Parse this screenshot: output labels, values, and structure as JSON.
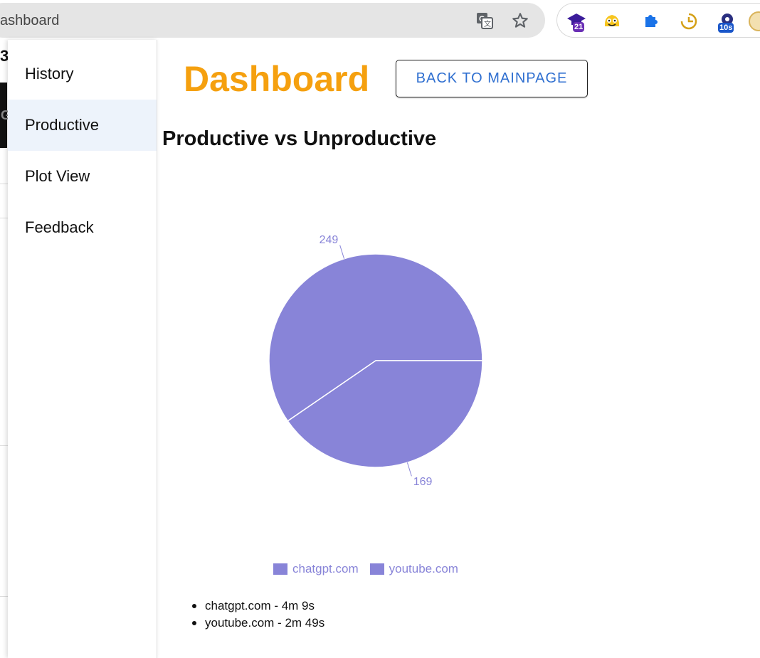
{
  "browser": {
    "url_fragment": "ashboard",
    "extensions": [
      {
        "name": "graduation-cap-extension",
        "badge": "21",
        "badge_color": "#6a2fb5"
      },
      {
        "name": "cartoon-face-extension"
      },
      {
        "name": "puzzle-extension"
      },
      {
        "name": "clock-extension"
      },
      {
        "name": "timer-extension",
        "badge": "10s",
        "badge_color": "#1a56c9"
      }
    ]
  },
  "sidebar": {
    "items": [
      {
        "label": "History"
      },
      {
        "label": "Productive",
        "active": true
      },
      {
        "label": "Plot View"
      },
      {
        "label": "Feedback"
      }
    ]
  },
  "header": {
    "title": "Dashboard",
    "back_button": "BACK TO MAINPAGE",
    "title_color": "#f5a00f",
    "button_text_color": "#2f6fd0"
  },
  "chart_title": "Productive vs Unproductive",
  "chart_data": {
    "type": "pie",
    "slices": [
      {
        "name": "chatgpt.com",
        "value": 249
      },
      {
        "name": "youtube.com",
        "value": 169
      }
    ],
    "color": "#8884d8",
    "legend_position": "bottom"
  },
  "usage_list": [
    {
      "text": "chatgpt.com - 4m 9s"
    },
    {
      "text": "youtube.com - 2m 49s"
    }
  ]
}
